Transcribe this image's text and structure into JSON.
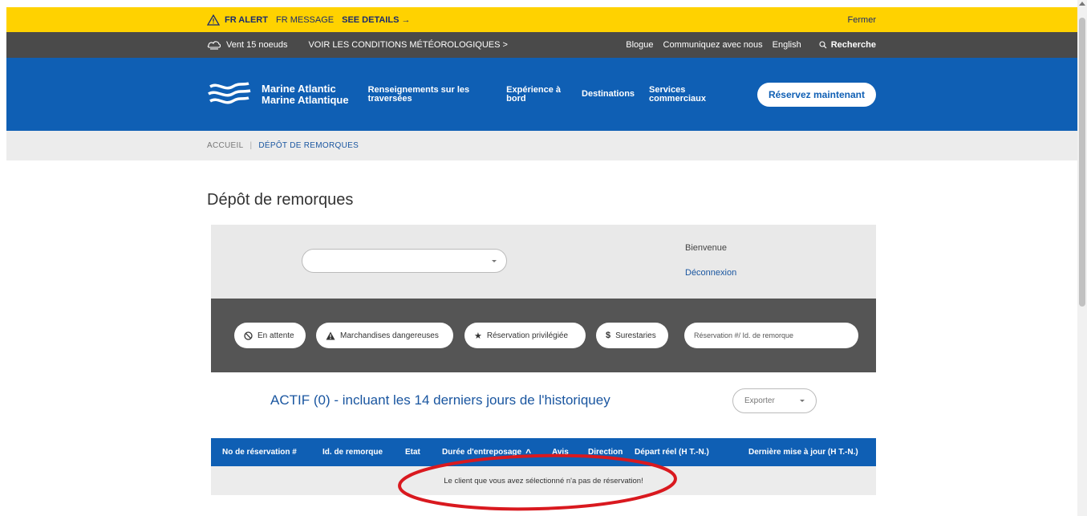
{
  "alert": {
    "title": "FR ALERT",
    "message": "FR MESSAGE",
    "details_link": "SEE DETAILS →",
    "close_label": "Fermer"
  },
  "utility": {
    "wind": "Vent 15 noeuds",
    "conditions_link": "VOIR LES CONDITIONS MÉTÉOROLOGIQUES  >",
    "blog": "Blogue",
    "contact": "Communiquez avec nous",
    "language": "English",
    "search": "Recherche"
  },
  "nav": {
    "logo_line1": "Marine Atlantic",
    "logo_line2": "Marine Atlantique",
    "items": [
      {
        "line1": "Renseignements sur les",
        "line2": "traversées"
      },
      {
        "line1": "Expérience à",
        "line2": "bord"
      },
      {
        "line1": "Destinations",
        "line2": ""
      },
      {
        "line1": "Services",
        "line2": "commerciaux"
      }
    ],
    "reserve_button": "Réservez maintenant"
  },
  "breadcrumb": {
    "home": "ACCUEIL",
    "separator": "|",
    "current": "DÉPÔT DE REMORQUES"
  },
  "page": {
    "title": "Dépôt de remorques"
  },
  "account": {
    "client_select_value": "",
    "welcome": "Bienvenue",
    "logout": "Déconnexion"
  },
  "filters": {
    "pending": "En attente",
    "dangerous": "Marchandises dangereuses",
    "priority": "Réservation privilégiée",
    "demurrage": "Surestaries",
    "search_placeholder": "Réservation #/ Id. de remorque"
  },
  "results": {
    "heading": "ACTIF (0) - incluant les 14 derniers jours de l'historiquey",
    "export_label": "Exporter"
  },
  "table": {
    "columns": [
      "No de réservation #",
      "Id. de remorque",
      "Etat",
      "Durée d'entreposage",
      "Avis",
      "Direction",
      "Départ réel (H T.-N.)",
      "Dernière mise à jour (H T.-N.)"
    ],
    "empty_message": "Le client que vous avez sélectionné n'a pas de réservation!"
  },
  "colors": {
    "alert_yellow": "#ffd200",
    "utility_grey": "#4a4a4a",
    "brand_blue": "#0f5fb4",
    "annotation_red": "#d9191f"
  }
}
